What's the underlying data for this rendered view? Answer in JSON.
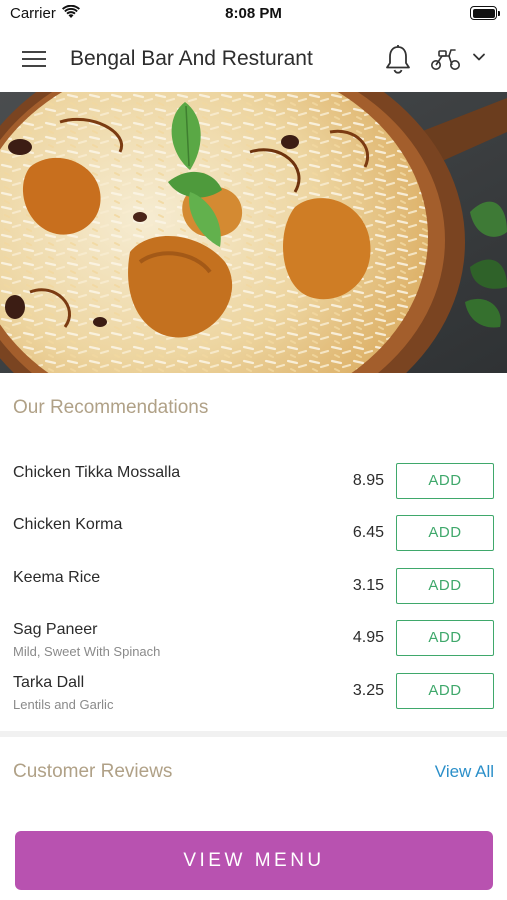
{
  "status_bar": {
    "carrier": "Carrier",
    "time": "8:08 PM"
  },
  "header": {
    "title": "Bengal Bar And Resturant"
  },
  "recommendations": {
    "title": "Our Recommendations",
    "add_label": "ADD",
    "items": [
      {
        "name": "Chicken Tikka Mossalla",
        "description": "",
        "price": "8.95"
      },
      {
        "name": "Chicken Korma",
        "description": "",
        "price": "6.45"
      },
      {
        "name": "Keema Rice",
        "description": "",
        "price": "3.15"
      },
      {
        "name": "Sag Paneer",
        "description": "Mild, Sweet With Spinach",
        "price": "4.95"
      },
      {
        "name": "Tarka Dall",
        "description": "Lentils and Garlic",
        "price": "3.25"
      }
    ]
  },
  "reviews": {
    "title": "Customer Reviews",
    "view_all_label": "View All"
  },
  "footer": {
    "view_menu_label": "VIEW MENU"
  },
  "colors": {
    "accent_purple": "#b852b0",
    "add_green": "#3fa86b",
    "section_title": "#b0a187",
    "link_blue": "#2b8fc9"
  }
}
